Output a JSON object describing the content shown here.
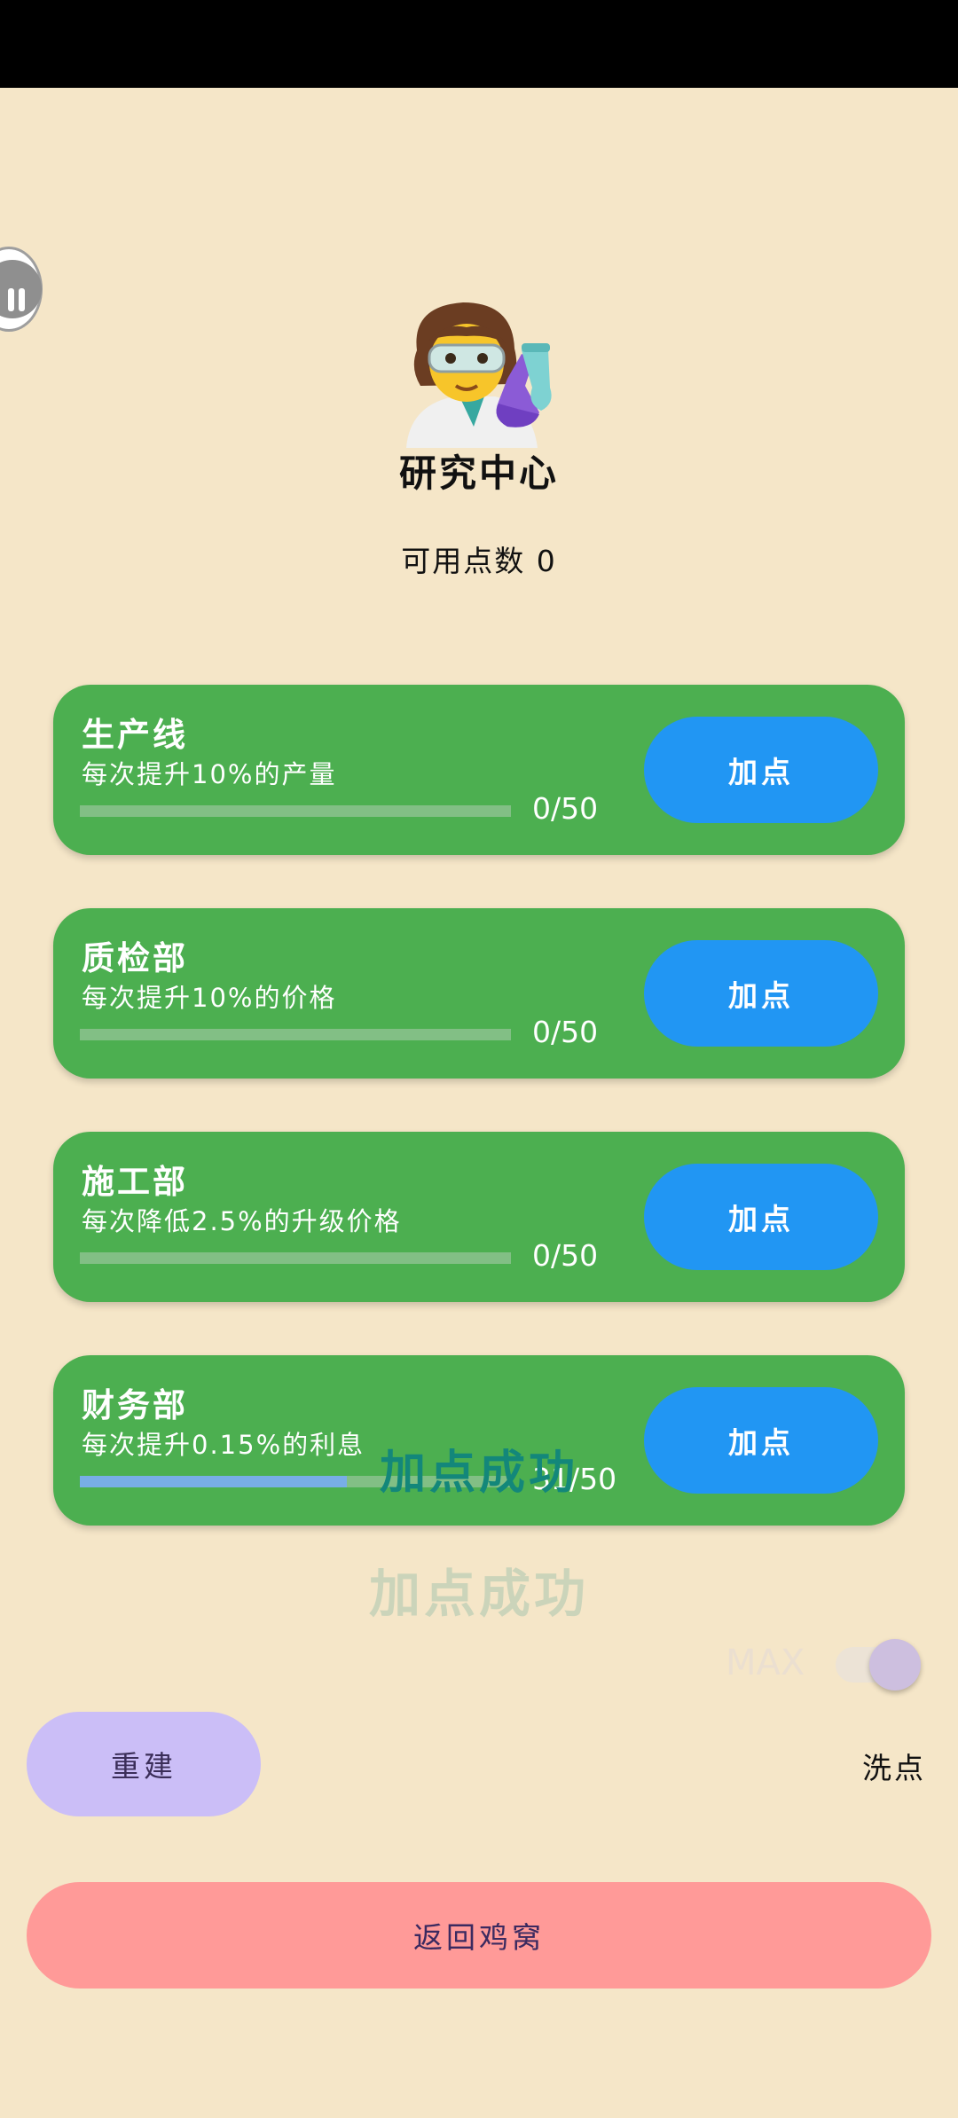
{
  "header": {
    "avatar_icon": "scientist-emoji",
    "title": "研究中心",
    "available_points": "可用点数 0"
  },
  "floating_button": {
    "icon": "pause-icon"
  },
  "research_items": [
    {
      "name": "生产线",
      "description": "每次提升10%的产量",
      "progress_text": "0/50",
      "progress": 0,
      "button_label": "加点"
    },
    {
      "name": "质检部",
      "description": "每次提升10%的价格",
      "progress_text": "0/50",
      "progress": 0,
      "button_label": "加点"
    },
    {
      "name": "施工部",
      "description": "每次降低2.5%的升级价格",
      "progress_text": "0/50",
      "progress": 0,
      "button_label": "加点"
    },
    {
      "name": "财务部",
      "description": "每次提升0.15%的利息",
      "progress_text": "31/50",
      "progress": 0.62,
      "button_label": "加点"
    }
  ],
  "toasts": [
    "加点成功",
    "加点成功"
  ],
  "max_toggle": {
    "label": "MAX",
    "on": false
  },
  "actions": {
    "rebuild": "重建",
    "reset_points": "洗点",
    "back": "返回鸡窝"
  },
  "colors": {
    "background": "#f5e6c8",
    "card": "#4caf50",
    "add_button": "#2196f3",
    "progress_fill": "#78aee6",
    "rebuild_button": "#cbbef7",
    "back_button": "#ff9a98"
  }
}
